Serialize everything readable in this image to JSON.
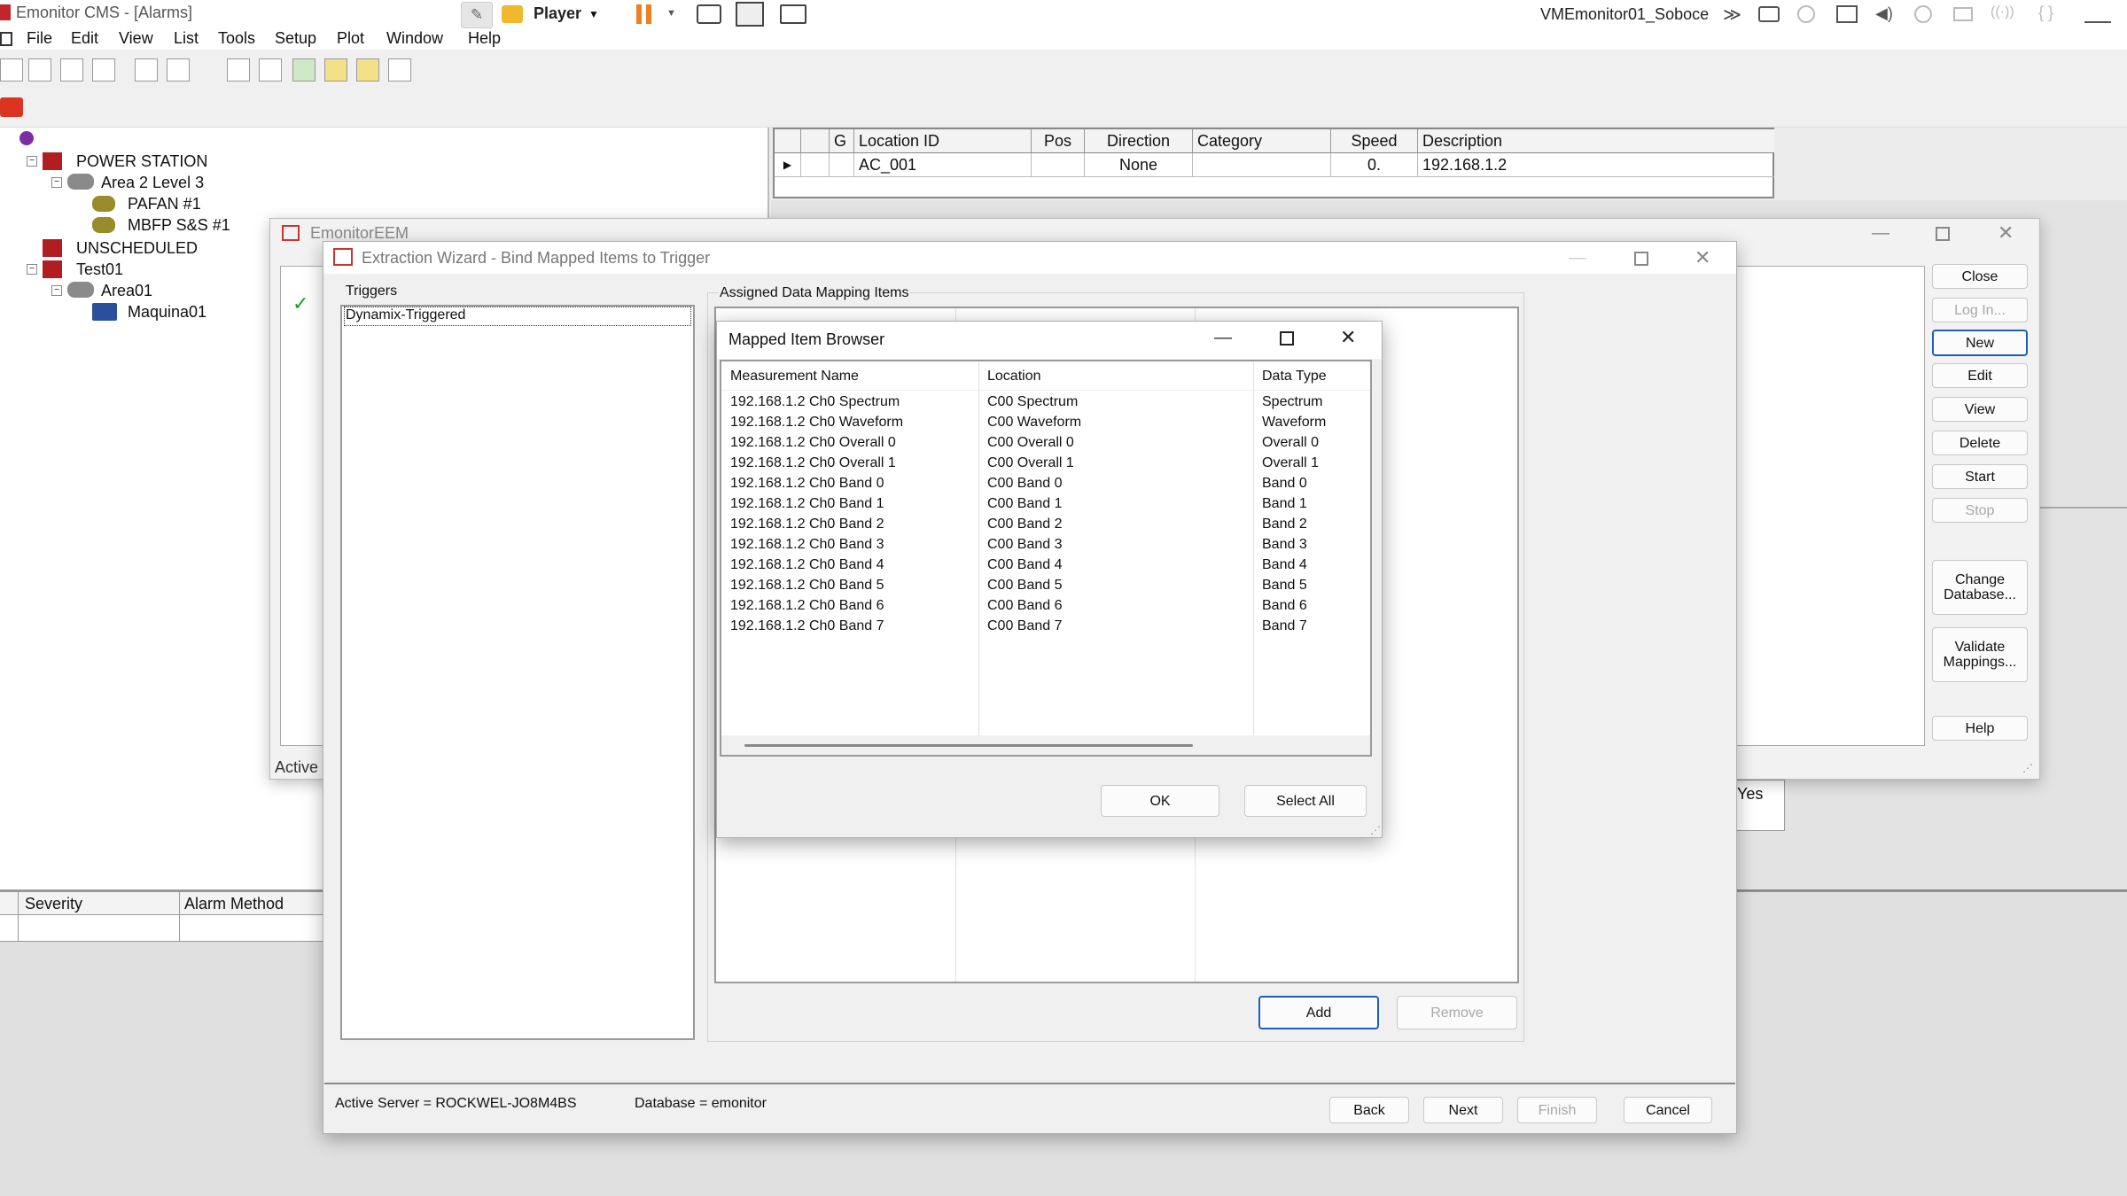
{
  "app": {
    "title": "Emonitor CMS - [Alarms]",
    "menu": [
      "File",
      "Edit",
      "View",
      "List",
      "Tools",
      "Setup",
      "Plot",
      "Window",
      "Help"
    ]
  },
  "topbar": {
    "player_label": "Player",
    "machine_name": "VMEmonitor01_Soboce"
  },
  "tree": {
    "items": [
      {
        "label": "POWER STATION",
        "icon": "factory-icon"
      },
      {
        "label": "Area 2 Level 3",
        "icon": "area-icon"
      },
      {
        "label": "PAFAN #1",
        "icon": "machine-icon"
      },
      {
        "label": "MBFP S&S #1",
        "icon": "machine-icon"
      },
      {
        "label": "UNSCHEDULED",
        "icon": "factory-icon"
      },
      {
        "label": "Test01",
        "icon": "factory-icon"
      },
      {
        "label": "Area01",
        "icon": "area-icon"
      },
      {
        "label": "Maquina01",
        "icon": "machine-icon"
      }
    ]
  },
  "location_grid": {
    "headers": [
      "G",
      "Location ID",
      "Pos",
      "Direction",
      "Category",
      "Speed",
      "Description"
    ],
    "row": {
      "location_id": "AC_001",
      "pos": "",
      "direction": "None",
      "category": "",
      "speed": "0.",
      "description": "192.168.1.2"
    }
  },
  "alarm_grid": {
    "headers": [
      "Severity",
      "Alarm Method"
    ]
  },
  "eem": {
    "title": "EmonitorEEM",
    "status_fragment": "Active",
    "side_fragment": "Yes",
    "buttons": [
      "Close",
      "Log In...",
      "New",
      "Edit",
      "View",
      "Delete",
      "Start",
      "Stop",
      "Change Database...",
      "Validate Mappings...",
      "Help"
    ]
  },
  "wizard": {
    "title": "Extraction Wizard - Bind Mapped Items to Trigger",
    "triggers_label": "Triggers",
    "triggers": [
      "Dynamix-Triggered"
    ],
    "assigned_label": "Assigned Data Mapping Items",
    "add_label": "Add",
    "remove_label": "Remove",
    "status": {
      "server": "Active Server = ROCKWEL-JO8M4BS",
      "database": "Database = emonitor"
    },
    "nav": {
      "back": "Back",
      "next": "Next",
      "finish": "Finish",
      "cancel": "Cancel"
    }
  },
  "browser": {
    "title": "Mapped Item Browser",
    "columns": [
      "Measurement Name",
      "Location",
      "Data Type"
    ],
    "rows": [
      [
        "192.168.1.2 Ch0 Spectrum",
        "C00 Spectrum",
        "Spectrum"
      ],
      [
        "192.168.1.2 Ch0 Waveform",
        "C00 Waveform",
        "Waveform"
      ],
      [
        "192.168.1.2 Ch0 Overall 0",
        "C00 Overall 0",
        "Overall 0"
      ],
      [
        "192.168.1.2 Ch0 Overall 1",
        "C00 Overall 1",
        "Overall 1"
      ],
      [
        "192.168.1.2 Ch0 Band 0",
        "C00 Band 0",
        "Band 0"
      ],
      [
        "192.168.1.2 Ch0 Band 1",
        "C00 Band 1",
        "Band 1"
      ],
      [
        "192.168.1.2 Ch0 Band 2",
        "C00 Band 2",
        "Band 2"
      ],
      [
        "192.168.1.2 Ch0 Band 3",
        "C00 Band 3",
        "Band 3"
      ],
      [
        "192.168.1.2 Ch0 Band 4",
        "C00 Band 4",
        "Band 4"
      ],
      [
        "192.168.1.2 Ch0 Band 5",
        "C00 Band 5",
        "Band 5"
      ],
      [
        "192.168.1.2 Ch0 Band 6",
        "C00 Band 6",
        "Band 6"
      ],
      [
        "192.168.1.2 Ch0 Band 7",
        "C00 Band 7",
        "Band 7"
      ]
    ],
    "ok_label": "OK",
    "select_all_label": "Select All"
  }
}
